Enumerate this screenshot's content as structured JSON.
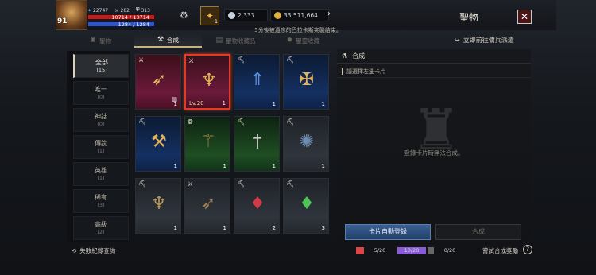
{
  "player": {
    "level": "91",
    "stat1": "22747",
    "stat2": "282",
    "stat3": "313",
    "hp": "10714 / 10714",
    "mp": "1284 / 1284",
    "charge_count": "1"
  },
  "currency": [
    {
      "name": "diamond-icon",
      "value": "2,333"
    },
    {
      "name": "gold-icon",
      "value": "33,511,664"
    }
  ],
  "header": {
    "title": "聖物",
    "notice": "5分後被遺忘的巴拉卡斯突襲結束。"
  },
  "tabs": [
    {
      "label": "聖物",
      "icon": "relic-icon",
      "active": false
    },
    {
      "label": "合成",
      "icon": "anvil-icon",
      "active": true
    },
    {
      "label": "聖物收藏品",
      "icon": "collection-icon",
      "active": false
    },
    {
      "label": "聖靈收藏",
      "icon": "spirit-icon",
      "active": false
    }
  ],
  "goto_link": "立即前往傭兵派遣",
  "categories": [
    {
      "name": "全部",
      "count": "(15)",
      "active": true
    },
    {
      "name": "唯一",
      "count": "(0)"
    },
    {
      "name": "神話",
      "count": "(0)"
    },
    {
      "name": "傳說",
      "count": "(1)"
    },
    {
      "name": "英雄",
      "count": "(1)"
    },
    {
      "name": "稀有",
      "count": "(3)"
    },
    {
      "name": "高級",
      "count": "(2)"
    }
  ],
  "items": [
    {
      "grade": "red",
      "icon": "bow-icon",
      "qty": "1",
      "level": ""
    },
    {
      "grade": "red",
      "icon": "horned-helmet-icon",
      "qty": "1",
      "level": "Lv.20",
      "selected": true
    },
    {
      "grade": "blue",
      "icon": "spear-icon",
      "qty": "1",
      "level": ""
    },
    {
      "grade": "blue",
      "icon": "crossbow-icon",
      "qty": "1",
      "level": ""
    },
    {
      "grade": "blue",
      "icon": "hammer-icon",
      "qty": "1",
      "level": ""
    },
    {
      "grade": "green",
      "icon": "staff-icon",
      "qty": "1",
      "level": ""
    },
    {
      "grade": "green",
      "icon": "dagger-icon",
      "qty": "1",
      "level": ""
    },
    {
      "grade": "gray",
      "icon": "mace-icon",
      "qty": "1",
      "level": ""
    },
    {
      "grade": "gray",
      "icon": "horned-helmet-icon",
      "qty": "1",
      "level": ""
    },
    {
      "grade": "gray",
      "icon": "bow-icon",
      "qty": "1",
      "level": ""
    },
    {
      "grade": "gray",
      "icon": "red-fang-icon",
      "qty": "2",
      "level": ""
    },
    {
      "grade": "gray",
      "icon": "green-fang-icon",
      "qty": "3",
      "level": ""
    }
  ],
  "right_panel": {
    "title": "合成",
    "subtitle": "請選擇左邊卡片",
    "message": "登錄卡片時無法合成。",
    "auto_register": "卡片自動登錄",
    "compose": "合成"
  },
  "bottom": {
    "fail_log": "失敗紀錄查詢",
    "progress": [
      {
        "value": "5/20",
        "color": "#d8474a",
        "fraction": 0.25
      },
      {
        "value": "10/20",
        "color": "#8a5bd6",
        "fraction": 0.5
      },
      {
        "value": "0/20",
        "color": "#888888",
        "fraction": 0
      }
    ],
    "try_reward": "嘗試合成獎勵"
  }
}
